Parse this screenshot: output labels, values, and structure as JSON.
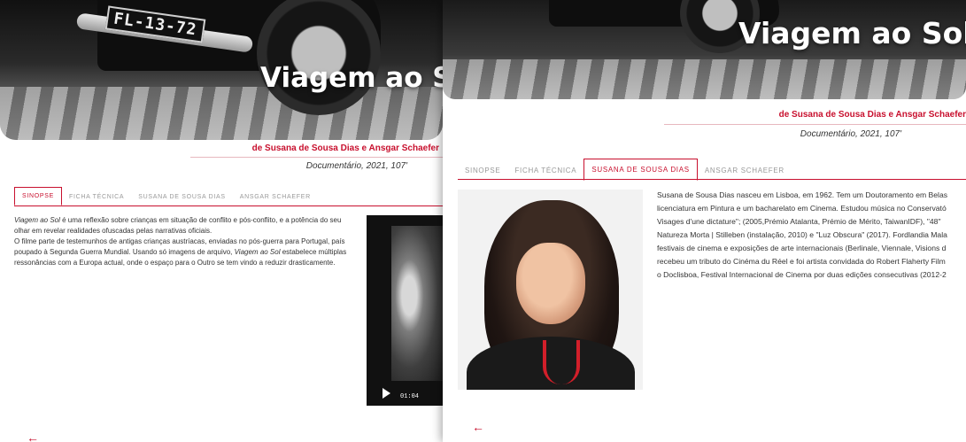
{
  "film": {
    "title": "Viagem ao Sol",
    "credits": "de Susana de Sousa Dias e Ansgar Schaefer",
    "meta": "Documentário, 2021, 107'",
    "plate": "FL-13-72"
  },
  "tabs": [
    "SINOPSE",
    "FICHA TÉCNICA",
    "SUSANA DE SOUSA DIAS",
    "ANSGAR SCHAEFER"
  ],
  "left_page": {
    "active_tab": "SINOPSE",
    "synopsis": [
      {
        "em": "Viagem ao Sol",
        "text": " é uma reflexão sobre crianças em situação de conflito e pós-conflito, e a potência do seu"
      },
      {
        "em": "",
        "text": "olhar em revelar realidades ofuscadas pelas narrativas oficiais."
      },
      {
        "em": "",
        "text": "O filme parte de testemunhos de antigas crianças austríacas, enviadas no pós-guerra para Portugal, país"
      },
      {
        "em": "",
        "text": "poupado à Segunda Guerra Mundial. Usando só imagens de arquivo, "
      },
      {
        "em": "",
        "text": "ressonâncias com a Europa actual, onde o espaço para o Outro se tem vindo a reduzir drasticamente."
      }
    ],
    "line4_em": "Viagem ao Sol",
    "line4_tail": " estabelece múltiplas",
    "video_time": "01:04"
  },
  "right_page": {
    "active_tab": "SUSANA DE SOUSA DIAS",
    "bio_lines": [
      "Susana de Sousa Dias nasceu em Lisboa, em 1962. Tem um Doutoramento em Belas",
      "licenciatura em Pintura e um bacharelato em Cinema. Estudou música no Conservató",
      "Visages d'une dictature\"; (2005,Prémio Atalanta, Prémio de Mérito, TaiwanIDF), \"48\"",
      "Natureza Morta | Stilleben (instalação, 2010) e \"Luz Obscura\" (2017). Fordlandia Mala",
      "festivais de cinema e exposições de arte internacionais (Berlinale, Viennale, Visions d",
      "recebeu um tributo do Cinéma du Réel e foi artista convidada do Robert Flaherty Film",
      "o Doclisboa, Festival Internacional de Cinema por duas edições consecutivas (2012-2"
    ]
  },
  "back_arrow": "←",
  "colors": {
    "accent": "#c8102e"
  }
}
